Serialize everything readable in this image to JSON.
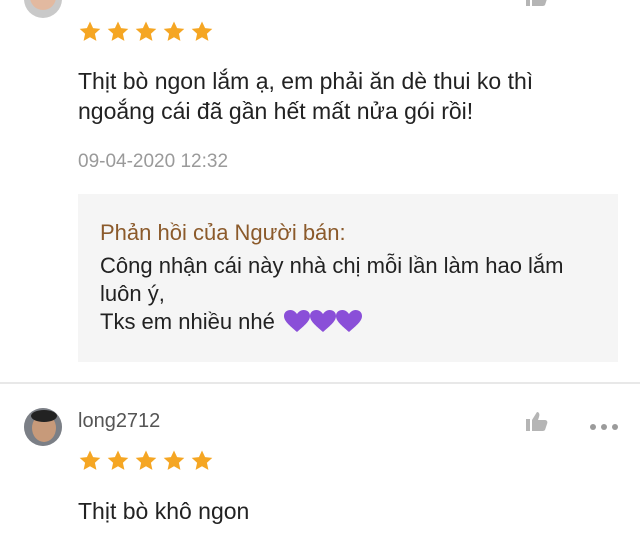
{
  "review1": {
    "rating": 5,
    "text": "Thịt bò ngon lắm ạ, em phải ăn dè thui ko thì ngoắng cái đã gần hết mất nửa gói rồi!",
    "timestamp": "09-04-2020 12:32",
    "seller_reply": {
      "label": "Phản hồi của Người bán:",
      "line1": "Công nhận cái này nhà chị mỗi lần làm hao lắm luôn ý,",
      "line2": "Tks em nhiều nhé"
    }
  },
  "review2": {
    "username": "long2712",
    "rating": 5,
    "text": "Thịt bò khô ngon"
  },
  "colors": {
    "star": "#f5a623",
    "seller_label": "#8b5a2b",
    "heart": "#8a4fd8",
    "timestamp": "#9a9a9a"
  },
  "icons": [
    "star-icon",
    "like-icon",
    "more-icon",
    "purple-heart-icon"
  ]
}
